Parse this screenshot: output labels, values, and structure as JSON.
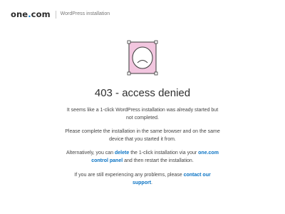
{
  "header": {
    "logo_name": "one",
    "logo_dot": ".",
    "logo_tld": "com",
    "subtitle": "WordPress installation"
  },
  "illustration": {
    "icon": "sad-face-document-icon",
    "fill_color": "#f2c6df",
    "stroke_color": "#3a3a3a"
  },
  "main": {
    "heading": "403 - access denied",
    "paragraph1": "It seems like a 1-click WordPress installation was already started but not completed.",
    "paragraph2": "Please complete the installation in the same browser and on the same device that you started it from.",
    "paragraph3": {
      "before": "Alternatively, you can ",
      "delete_link": "delete",
      "middle": " the 1-click installation via your ",
      "control_panel_link": "one.com control panel",
      "after": " and then restart the installation."
    },
    "paragraph4": {
      "before": "If you are still experiencing any problems, please ",
      "support_link": "contact our support",
      "after": "."
    }
  },
  "colors": {
    "accent": "#0a73c4",
    "text": "#444444",
    "heading": "#2e2e2e"
  }
}
